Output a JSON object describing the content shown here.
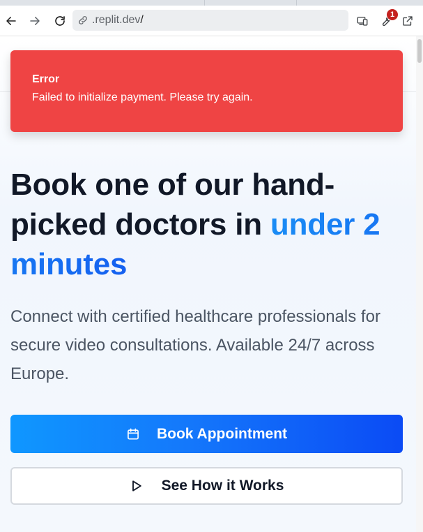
{
  "browser": {
    "url_host": ".replit.dev",
    "url_path": "/",
    "extensions_badge": "1"
  },
  "toast": {
    "title": "Error",
    "message": "Failed to initialize payment. Please try again.",
    "color": "#ef4444"
  },
  "hero": {
    "title_part1": "Book one of our hand-picked doctors in ",
    "title_accent": "under 2 minutes",
    "subtitle": "Connect with certified healthcare professionals for secure video consultations. Available 24/7 across Europe."
  },
  "actions": {
    "primary_label": "Book Appointment",
    "primary_icon": "calendar-icon",
    "secondary_label": "See How it Works",
    "secondary_icon": "play-icon"
  },
  "colors": {
    "accent": "#1478fb",
    "text": "#111827",
    "muted": "#4b5563"
  }
}
